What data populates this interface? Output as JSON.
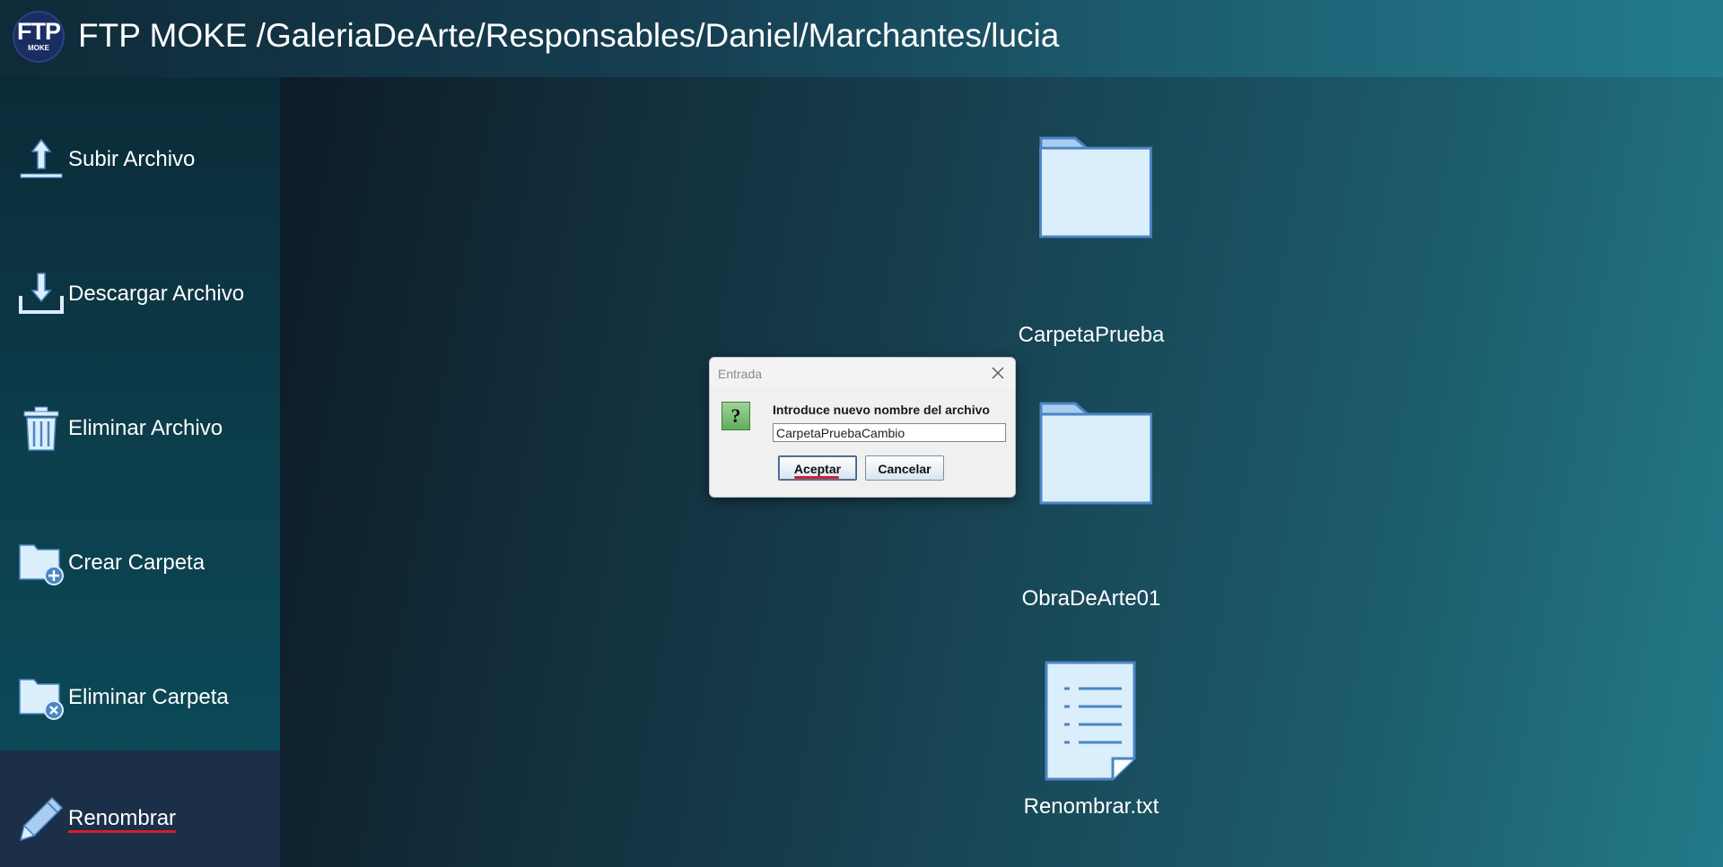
{
  "header": {
    "logo_text": "FTP",
    "logo_subtext": "MOKE",
    "title": "FTP MOKE /GaleriaDeArte/Responsables/Daniel/Marchantes/lucia"
  },
  "sidebar": {
    "items": [
      {
        "label": "Subir Archivo",
        "icon": "upload-icon"
      },
      {
        "label": "Descargar Archivo",
        "icon": "download-icon"
      },
      {
        "label": "Eliminar Archivo",
        "icon": "trash-icon"
      },
      {
        "label": "Crear Carpeta",
        "icon": "folder-add-icon"
      },
      {
        "label": "Eliminar Carpeta",
        "icon": "folder-delete-icon"
      },
      {
        "label": "Renombrar",
        "icon": "pencil-icon",
        "selected": true
      }
    ]
  },
  "files": [
    {
      "name": "CarpetaPrueba",
      "type": "folder"
    },
    {
      "name": "ObraDeArte01",
      "type": "folder"
    },
    {
      "name": "Renombrar.txt",
      "type": "text-file"
    }
  ],
  "dialog": {
    "title": "Entrada",
    "message": "Introduce nuevo nombre del archivo",
    "input_value": "CarpetaPruebaCambio",
    "accept_label": "Aceptar",
    "cancel_label": "Cancelar",
    "icon": "question-icon"
  },
  "colors": {
    "icon_fill": "#dbeefc",
    "icon_stroke": "#4b86c4",
    "selected_underline": "#d3202a",
    "sidebar_selected_bg": "#1b3048"
  }
}
